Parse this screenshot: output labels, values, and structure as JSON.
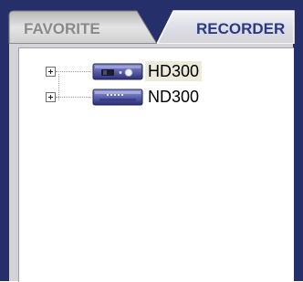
{
  "tabs": {
    "favorite_label": "FAVORITE",
    "recorder_label": "RECORDER",
    "active": "RECORDER"
  },
  "tree": {
    "items": [
      {
        "label": "HD300",
        "icon": "hd-recorder-device-icon",
        "expanded": false,
        "selected": true
      },
      {
        "label": "ND300",
        "icon": "nd-recorder-device-icon",
        "expanded": false,
        "selected": false
      }
    ]
  },
  "colors": {
    "frame": "#25306a",
    "active_tab": "#2a3a86",
    "inactive_tab": "#8a8a8a",
    "selection": "#ecebdc"
  }
}
